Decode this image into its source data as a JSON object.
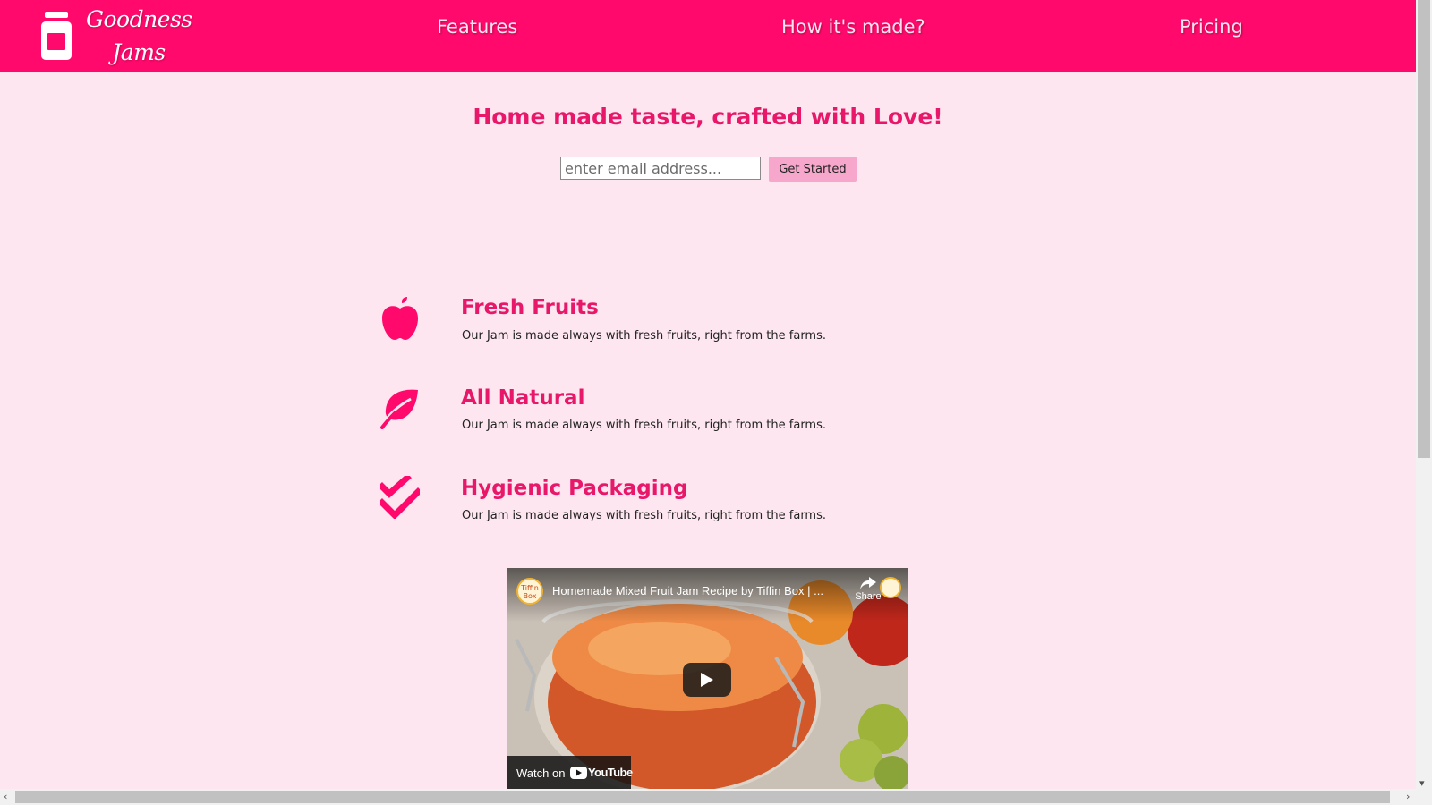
{
  "colors": {
    "accent": "#ff0a6c",
    "background": "#fde6ef",
    "heading": "#e8176a",
    "button": "#f7a7cb"
  },
  "nav": {
    "brand_line1": "Goodness",
    "brand_line2": "Jams",
    "logo_icon": "jar-icon",
    "links": [
      {
        "label": "Features"
      },
      {
        "label": "How it's made?"
      },
      {
        "label": "Pricing"
      }
    ]
  },
  "hero": {
    "title": "Home made taste, crafted with Love!",
    "email_placeholder": "enter email address...",
    "cta_label": "Get Started"
  },
  "features": [
    {
      "icon": "apple-icon",
      "title": "Fresh Fruits",
      "text": "Our Jam is made always with fresh fruits, right from the farms."
    },
    {
      "icon": "leaf-icon",
      "title": "All Natural",
      "text": "Our Jam is made always with fresh fruits, right from the farms."
    },
    {
      "icon": "double-check-icon",
      "title": "Hygienic Packaging",
      "text": "Our Jam is made always with fresh fruits, right from the farms."
    }
  ],
  "video": {
    "title": "Homemade Mixed Fruit Jam Recipe by Tiffin Box | ...",
    "channel_name": "Tiffin Box",
    "share_label": "Share",
    "watch_on_label": "Watch on",
    "platform_label": "YouTube"
  }
}
